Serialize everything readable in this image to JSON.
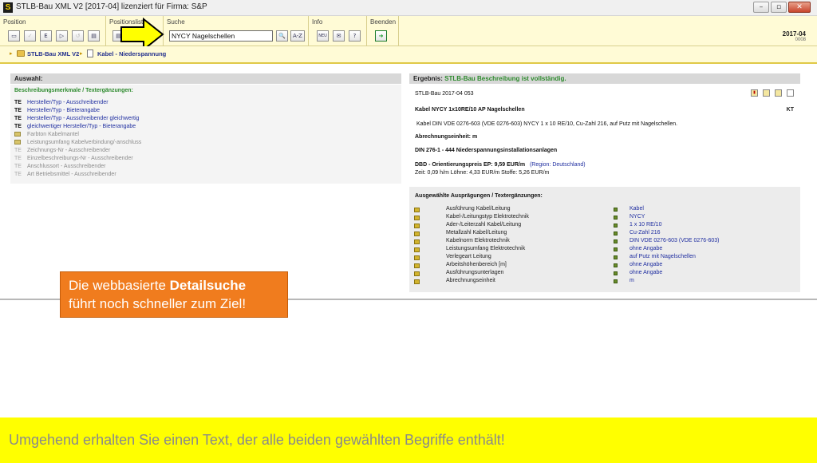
{
  "window": {
    "app_icon_letter": "S",
    "title": "STLB-Bau XML V2 [2017-04] lizenziert für Firma: S&P",
    "buttons": [
      "–",
      "▫",
      "✕"
    ]
  },
  "toolbar": {
    "groups": [
      "Position",
      "Positionsliste",
      "Suche",
      "Info",
      "Beenden"
    ],
    "search_value": "NYCY Nagelschellen",
    "search_buttons": [
      "🔍",
      "A-Z"
    ],
    "info_buttons": [
      "NEU",
      "✉",
      "?"
    ],
    "position_buttons": [
      "▭",
      "✓",
      "E",
      "▷",
      "↺",
      "▤"
    ],
    "version": "2017-04",
    "version_sub": "0008"
  },
  "breadcrumb": {
    "items": [
      "STLB-Bau XML V2",
      "Kabel - Niederspannung"
    ]
  },
  "left_panel": {
    "title": "Auswahl:",
    "subtitle": "Beschreibungsmerkmale / Textergänzungen:",
    "rows": [
      {
        "tag": "TE",
        "text": "Hersteller/Typ - Ausschreibender",
        "active": true
      },
      {
        "tag": "TE",
        "text": "Hersteller/Typ - Bieterangabe",
        "active": true
      },
      {
        "tag": "TE",
        "text": "Hersteller/Typ - Ausschreibender gleichwertig",
        "active": true
      },
      {
        "tag": "TE",
        "text": "gleichwertiger Hersteller/Typ - Bieterangabe",
        "active": true
      },
      {
        "tag": "",
        "text": "Farbton Kabelmantel",
        "active": false
      },
      {
        "tag": "",
        "text": "Leistungsumfang Kabelverbindung/-anschluss",
        "active": false
      },
      {
        "tag": "TE",
        "text": "Zeichnungs-Nr - Ausschreibender",
        "active": false
      },
      {
        "tag": "TE",
        "text": "Einzelbeschreibungs-Nr - Ausschreibender",
        "active": false
      },
      {
        "tag": "TE",
        "text": "Anschlussort - Ausschreibender",
        "active": false
      },
      {
        "tag": "TE",
        "text": "Art Betriebsmittel - Ausschreibender",
        "active": false
      }
    ]
  },
  "right_panel": {
    "title_prefix": "Ergebnis:",
    "title_status": "STLB-Bau Beschreibung ist vollständig.",
    "code": "STLB-Bau 2017-04 053",
    "kt": "KT",
    "short_text": "Kabel NYCY 1x10RE/10 AP Nagelschellen",
    "long_text": "Kabel DIN VDE 0276-603 (VDE 0276-603) NYCY 1 x 10 RE/10, Cu-Zahl 216, auf Putz mit Nagelschellen.",
    "unit_line": "Abrechnungseinheit: m",
    "din_line": "DIN 276-1 - 444 Niederspannungsinstallationsanlagen",
    "price_line": "DBD - Orientierungspreis EP: 9,59 EUR/m",
    "region": "(Region: Deutschland)",
    "time_line": "Zeit: 0,09 h/m   Löhne: 4,33 EUR/m   Stoffe: 5,26 EUR/m",
    "selected_heading": "Ausgewählte Ausprägungen / Textergänzungen:",
    "selected": [
      {
        "name": "Ausführung Kabel/Leitung",
        "value": "Kabel"
      },
      {
        "name": "Kabel-/Leitungstyp Elektrotechnik",
        "value": "NYCY"
      },
      {
        "name": "Ader-/Leiterzahl Kabel/Leitung",
        "value": "1 x 10 RE/10"
      },
      {
        "name": "Metallzahl Kabel/Leitung",
        "value": "Cu-Zahl 216"
      },
      {
        "name": "Kabelnorm Elektrotechnik",
        "value": "DIN VDE 0276-603 (VDE 0276-603)"
      },
      {
        "name": "Leistungsumfang Elektrotechnik",
        "value": "ohne Angabe"
      },
      {
        "name": "Verlegeart Leitung",
        "value": "auf Putz mit Nagelschellen"
      },
      {
        "name": "Arbeitshöhenbereich [m]",
        "value": "ohne Angabe"
      },
      {
        "name": "Ausführungsunterlagen",
        "value": "ohne Angabe"
      },
      {
        "name": "Abrechnungseinheit",
        "value": "m"
      }
    ]
  },
  "callout": {
    "line1_pre": "Die webbasierte ",
    "line1_bold": "Detailsuche",
    "line2": "führt noch schneller zum Ziel!"
  },
  "footer_text": "Umgehend erhalten Sie einen Text, der alle beiden gewählten Begriffe enthält!",
  "colors": {
    "accent_yellow": "#ffff00",
    "callout_orange": "#f07c1e",
    "link_blue": "#1f2ea0",
    "status_green": "#2d8a2d"
  }
}
